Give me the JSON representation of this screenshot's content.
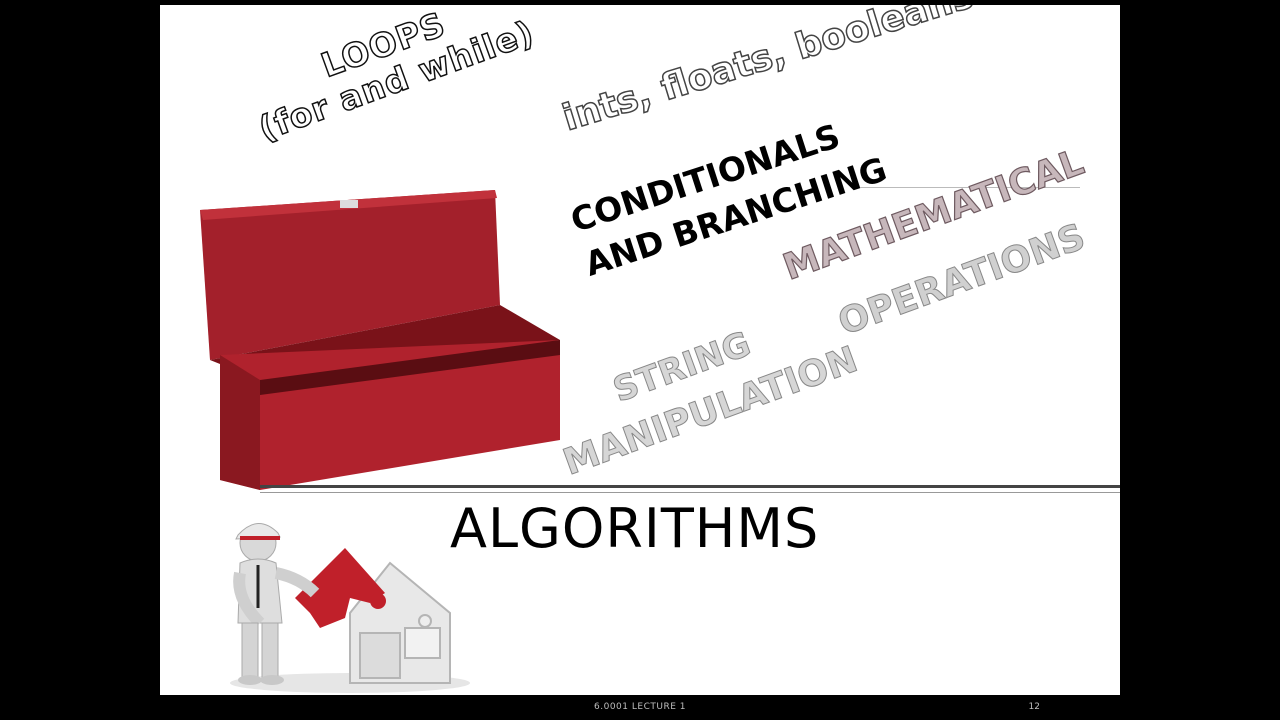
{
  "slide": {
    "loops_line1": "LOOPS",
    "loops_line2": "(for and while)",
    "ints": "ints, floats, booleans",
    "conditionals_line1": "CONDITIONALS",
    "conditionals_line2": "AND BRANCHING",
    "mathematical": "MATHEMATICAL",
    "operations": "OPERATIONS",
    "string": "STRING",
    "manipulation": "MANIPULATION",
    "algorithms": "ALGORITHMS"
  },
  "footer": {
    "lecture": "6.0001 LECTURE 1",
    "page_number": "12"
  },
  "colors": {
    "box_red": "#a3202b",
    "puzzle_red": "#c0202a",
    "background": "#000000",
    "slide": "#ffffff"
  }
}
